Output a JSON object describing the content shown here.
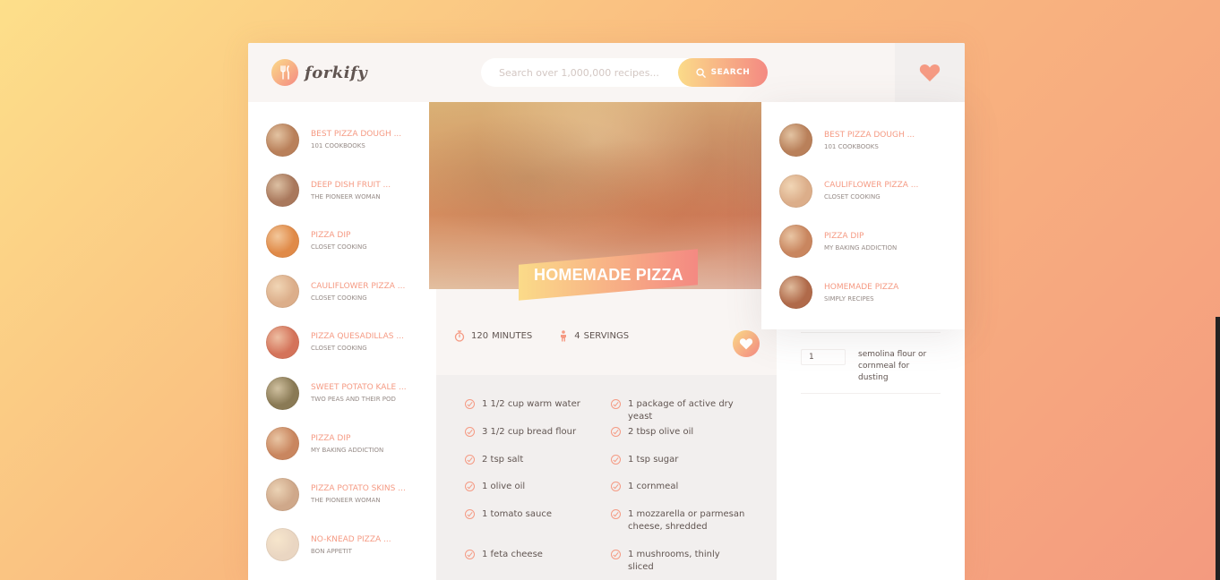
{
  "header": {
    "logo_text": "forkify",
    "search_placeholder": "Search over 1,000,000 recipes...",
    "search_button": "SEARCH"
  },
  "colors": {
    "accent": "#f59a83",
    "gradient_start": "#fbdb89",
    "gradient_end": "#f48982",
    "text": "#615551"
  },
  "results": [
    {
      "title": "BEST PIZZA DOUGH ...",
      "author": "101 COOKBOOKS",
      "thumb": "#b9805a"
    },
    {
      "title": "DEEP DISH FRUIT ...",
      "author": "THE PIONEER WOMAN",
      "thumb": "#a9785c"
    },
    {
      "title": "PIZZA DIP",
      "author": "CLOSET COOKING",
      "thumb": "#e08a48"
    },
    {
      "title": "CAULIFLOWER PIZZA ...",
      "author": "CLOSET COOKING",
      "thumb": "#dcae8a"
    },
    {
      "title": "PIZZA QUESADILLAS ...",
      "author": "CLOSET COOKING",
      "thumb": "#d4735a"
    },
    {
      "title": "SWEET POTATO KALE ...",
      "author": "TWO PEAS AND THEIR POD",
      "thumb": "#8a7a55"
    },
    {
      "title": "PIZZA DIP",
      "author": "MY BAKING ADDICTION",
      "thumb": "#c9865f"
    },
    {
      "title": "PIZZA POTATO SKINS ...",
      "author": "THE PIONEER WOMAN",
      "thumb": "#cfa88a"
    },
    {
      "title": "NO-KNEAD PIZZA ...",
      "author": "BON APPETIT",
      "thumb": "#ead6c2"
    }
  ],
  "recipe": {
    "title": "HOMEMADE PIZZA",
    "time": "120",
    "time_unit": "MINUTES",
    "servings": "4",
    "servings_unit": "SERVINGS",
    "ingredients": [
      "1 1/2 cup warm water",
      "1 package of active dry yeast",
      "3 1/2 cup bread flour",
      "2 tbsp olive oil",
      "2 tsp salt",
      "1 tsp sugar",
      "1 olive oil",
      "1 cornmeal",
      "1 tomato sauce",
      "1 mozzarella or parmesan cheese, shredded",
      "1 feta cheese",
      "1 mushrooms, thinly sliced"
    ]
  },
  "shopping": [
    {
      "qty": "1",
      "desc": "semolina flour or cornmeal for dusting"
    }
  ],
  "likes": [
    {
      "title": "BEST PIZZA DOUGH ...",
      "author": "101 COOKBOOKS",
      "thumb": "#b9805a"
    },
    {
      "title": "CAULIFLOWER PIZZA ...",
      "author": "CLOSET COOKING",
      "thumb": "#dcae8a"
    },
    {
      "title": "PIZZA DIP",
      "author": "MY BAKING ADDICTION",
      "thumb": "#c9865f"
    },
    {
      "title": "HOMEMADE PIZZA",
      "author": "SIMPLY RECIPES",
      "thumb": "#b06a4a"
    }
  ]
}
